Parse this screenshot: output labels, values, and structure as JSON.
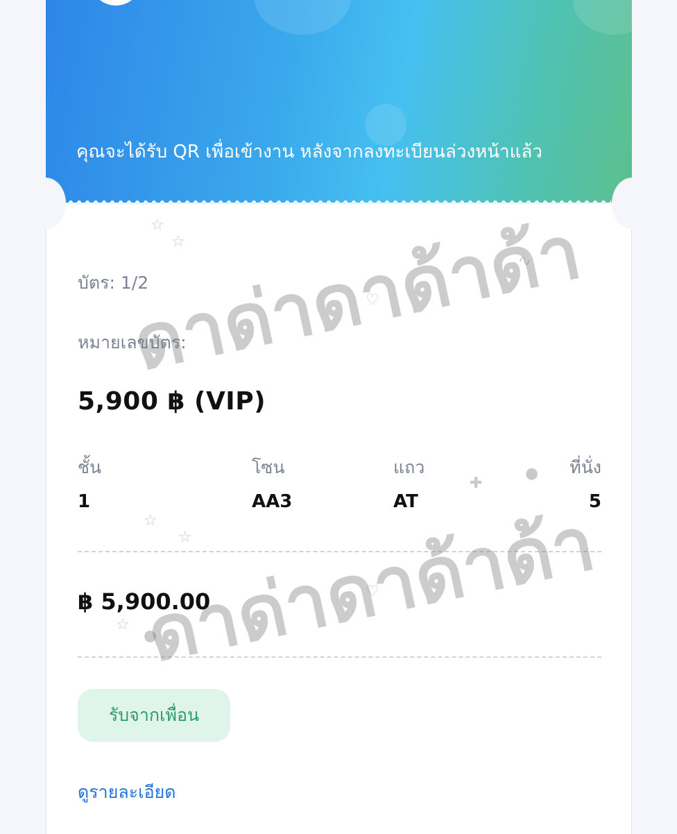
{
  "header": {
    "qr_notice": "คุณจะได้รับ QR เพื่อเข้างาน หลังจากลงทะเบียนล่วงหน้าแล้ว"
  },
  "ticket": {
    "ticket_count_label": "บัตร: 1/2",
    "ticket_number_label": "หมายเลขบัตร:",
    "price_title": "5,900 ฿ (VIP)",
    "seat": {
      "floor_label": "ชั้น",
      "floor_value": "1",
      "zone_label": "โซน",
      "zone_value": "AA3",
      "row_label": "แถว",
      "row_value": "AT",
      "seat_label": "ที่นั่ง",
      "seat_value": "5"
    },
    "total": "฿ 5,900.00"
  },
  "actions": {
    "receive_from_friend": "รับจากเพื่อน",
    "view_details": "ดูรายละเอียด"
  },
  "watermark": {
    "text": "ดาด่าดาด้าด้า"
  },
  "colors": {
    "header_gradient_start": "#2e86e8",
    "header_gradient_end": "#5dbf8e",
    "friend_button_bg": "#dff5ea",
    "friend_button_text": "#2f9a6a",
    "link": "#2573d9"
  }
}
